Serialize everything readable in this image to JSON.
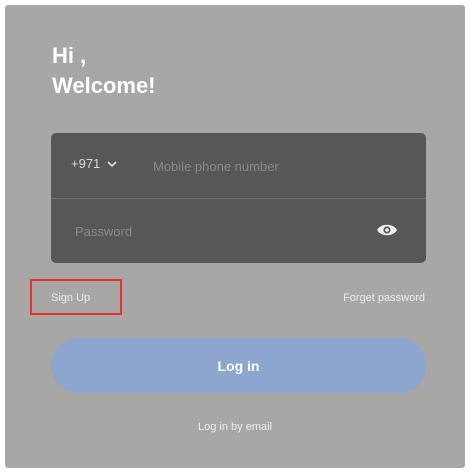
{
  "greeting": {
    "line1": "Hi ,",
    "line2": "Welcome!"
  },
  "form": {
    "country_code": "+971",
    "phone_placeholder": "Mobile phone number",
    "password_placeholder": "Password",
    "eye_icon": "eye-icon"
  },
  "links": {
    "sign_up": "Sign Up",
    "forgot_password": "Forget password",
    "login_by_email": "Log in by email"
  },
  "buttons": {
    "login": "Log in"
  },
  "colors": {
    "background": "#a9a7a5",
    "card": "#585756",
    "login_button": "#8da6cf",
    "highlight_box": "#e0332f"
  }
}
